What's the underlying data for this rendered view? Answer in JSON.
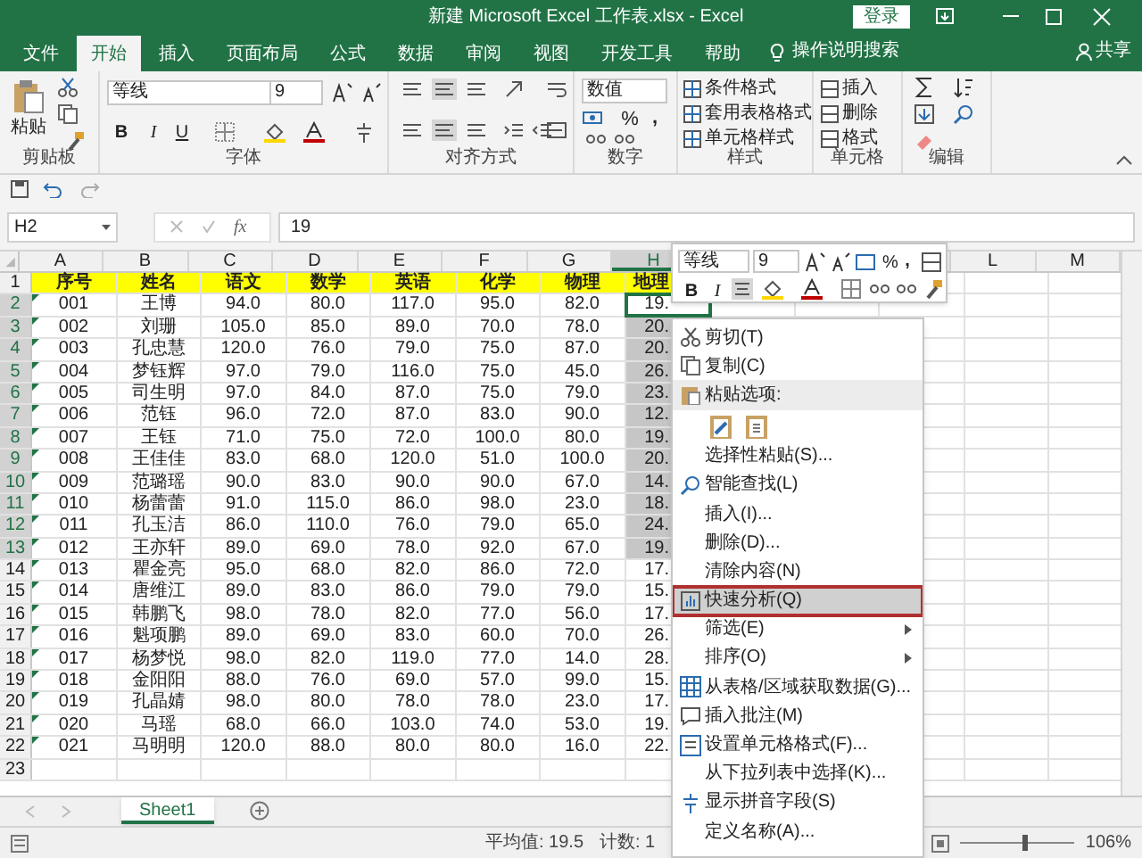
{
  "title_bar": {
    "title": "新建 Microsoft Excel 工作表.xlsx  -  Excel",
    "login": "登录"
  },
  "menu_tabs": [
    {
      "label": "文件",
      "selected": false
    },
    {
      "label": "开始",
      "selected": true
    },
    {
      "label": "插入",
      "selected": false
    },
    {
      "label": "页面布局",
      "selected": false
    },
    {
      "label": "公式",
      "selected": false
    },
    {
      "label": "数据",
      "selected": false
    },
    {
      "label": "审阅",
      "selected": false
    },
    {
      "label": "视图",
      "selected": false
    },
    {
      "label": "开发工具",
      "selected": false
    },
    {
      "label": "帮助",
      "selected": false
    }
  ],
  "tell_me": "操作说明搜索",
  "share": "共享",
  "ribbon": {
    "clipboard": {
      "paste": "粘贴",
      "label": "剪贴板"
    },
    "font": {
      "font_name": "等线",
      "font_size": "9",
      "bold": "B",
      "italic": "I",
      "underline": "U",
      "label": "字体"
    },
    "alignment": {
      "label": "对齐方式"
    },
    "number": {
      "format": "数值",
      "percent": "%",
      "comma": ",",
      "label": "数字"
    },
    "styles": {
      "buttons": [
        "条件格式",
        "套用表格格式",
        "单元格样式"
      ],
      "label": "样式"
    },
    "cells": {
      "buttons": [
        "插入",
        "删除",
        "格式"
      ],
      "label": "单元格"
    },
    "editing": {
      "label": "编辑"
    }
  },
  "formula_bar": {
    "name_box": "H2",
    "function_label": "fx",
    "value": "19"
  },
  "columns": [
    {
      "label": "A",
      "selected": false
    },
    {
      "label": "B",
      "selected": false
    },
    {
      "label": "C",
      "selected": false
    },
    {
      "label": "D",
      "selected": false
    },
    {
      "label": "E",
      "selected": false
    },
    {
      "label": "F",
      "selected": false
    },
    {
      "label": "G",
      "selected": false
    },
    {
      "label": "H",
      "selected": true
    },
    {
      "label": "L",
      "selected": false
    },
    {
      "label": "M",
      "selected": false
    }
  ],
  "rows": [
    {
      "number": "1",
      "kind": "header",
      "cells": [
        "序号",
        "姓名",
        "语文",
        "数学",
        "英语",
        "化学",
        "物理",
        "地理"
      ],
      "selected": false,
      "active": false,
      "flag": false
    },
    {
      "number": "2",
      "kind": "data",
      "cells": [
        "001",
        "王博",
        "94.0",
        "80.0",
        "117.0",
        "95.0",
        "82.0",
        "19."
      ],
      "selected": true,
      "active": true,
      "flag": true
    },
    {
      "number": "3",
      "kind": "data",
      "cells": [
        "002",
        "刘珊",
        "105.0",
        "85.0",
        "89.0",
        "70.0",
        "78.0",
        "20."
      ],
      "selected": true,
      "active": false,
      "flag": true
    },
    {
      "number": "4",
      "kind": "data",
      "cells": [
        "003",
        "孔忠慧",
        "120.0",
        "76.0",
        "79.0",
        "75.0",
        "87.0",
        "20."
      ],
      "selected": true,
      "active": false,
      "flag": true
    },
    {
      "number": "5",
      "kind": "data",
      "cells": [
        "004",
        "梦钰辉",
        "97.0",
        "79.0",
        "116.0",
        "75.0",
        "45.0",
        "26."
      ],
      "selected": true,
      "active": false,
      "flag": true
    },
    {
      "number": "6",
      "kind": "data",
      "cells": [
        "005",
        "司生明",
        "97.0",
        "84.0",
        "87.0",
        "75.0",
        "79.0",
        "23."
      ],
      "selected": true,
      "active": false,
      "flag": true
    },
    {
      "number": "7",
      "kind": "data",
      "cells": [
        "006",
        "范钰",
        "96.0",
        "72.0",
        "87.0",
        "83.0",
        "90.0",
        "12."
      ],
      "selected": true,
      "active": false,
      "flag": true
    },
    {
      "number": "8",
      "kind": "data",
      "cells": [
        "007",
        "王钰",
        "71.0",
        "75.0",
        "72.0",
        "100.0",
        "80.0",
        "19."
      ],
      "selected": true,
      "active": false,
      "flag": true
    },
    {
      "number": "9",
      "kind": "data",
      "cells": [
        "008",
        "王佳佳",
        "83.0",
        "68.0",
        "120.0",
        "51.0",
        "100.0",
        "20."
      ],
      "selected": true,
      "active": false,
      "flag": true
    },
    {
      "number": "10",
      "kind": "data",
      "cells": [
        "009",
        "范璐瑶",
        "90.0",
        "83.0",
        "90.0",
        "90.0",
        "67.0",
        "14."
      ],
      "selected": true,
      "active": false,
      "flag": true
    },
    {
      "number": "11",
      "kind": "data",
      "cells": [
        "010",
        "杨蕾蕾",
        "91.0",
        "115.0",
        "86.0",
        "98.0",
        "23.0",
        "18."
      ],
      "selected": true,
      "active": false,
      "flag": true
    },
    {
      "number": "12",
      "kind": "data",
      "cells": [
        "011",
        "孔玉洁",
        "86.0",
        "110.0",
        "76.0",
        "79.0",
        "65.0",
        "24."
      ],
      "selected": true,
      "active": false,
      "flag": true
    },
    {
      "number": "13",
      "kind": "data",
      "cells": [
        "012",
        "王亦轩",
        "89.0",
        "69.0",
        "78.0",
        "92.0",
        "67.0",
        "19."
      ],
      "selected": true,
      "active": false,
      "flag": true
    },
    {
      "number": "14",
      "kind": "data",
      "cells": [
        "013",
        "瞿金亮",
        "95.0",
        "68.0",
        "82.0",
        "86.0",
        "72.0",
        "17."
      ],
      "selected": false,
      "active": false,
      "flag": true
    },
    {
      "number": "15",
      "kind": "data",
      "cells": [
        "014",
        "唐维江",
        "89.0",
        "83.0",
        "86.0",
        "79.0",
        "79.0",
        "15."
      ],
      "selected": false,
      "active": false,
      "flag": true
    },
    {
      "number": "16",
      "kind": "data",
      "cells": [
        "015",
        "韩鹏飞",
        "98.0",
        "78.0",
        "82.0",
        "77.0",
        "56.0",
        "17."
      ],
      "selected": false,
      "active": false,
      "flag": true
    },
    {
      "number": "17",
      "kind": "data",
      "cells": [
        "016",
        "魁项鹏",
        "89.0",
        "69.0",
        "83.0",
        "60.0",
        "70.0",
        "26."
      ],
      "selected": false,
      "active": false,
      "flag": true
    },
    {
      "number": "18",
      "kind": "data",
      "cells": [
        "017",
        "杨梦悦",
        "98.0",
        "82.0",
        "119.0",
        "77.0",
        "14.0",
        "28."
      ],
      "selected": false,
      "active": false,
      "flag": true
    },
    {
      "number": "19",
      "kind": "data",
      "cells": [
        "018",
        "金阳阳",
        "88.0",
        "76.0",
        "69.0",
        "57.0",
        "99.0",
        "15."
      ],
      "selected": false,
      "active": false,
      "flag": true
    },
    {
      "number": "20",
      "kind": "data",
      "cells": [
        "019",
        "孔晶婧",
        "98.0",
        "80.0",
        "78.0",
        "78.0",
        "23.0",
        "17."
      ],
      "selected": false,
      "active": false,
      "flag": true
    },
    {
      "number": "21",
      "kind": "data",
      "cells": [
        "020",
        "马瑶",
        "68.0",
        "66.0",
        "103.0",
        "74.0",
        "53.0",
        "19."
      ],
      "selected": false,
      "active": false,
      "flag": true
    },
    {
      "number": "22",
      "kind": "data",
      "cells": [
        "021",
        "马明明",
        "120.0",
        "88.0",
        "80.0",
        "80.0",
        "16.0",
        "22."
      ],
      "selected": false,
      "active": false,
      "flag": true
    },
    {
      "number": "23",
      "kind": "data",
      "cells": [],
      "selected": false,
      "active": false,
      "flag": false
    }
  ],
  "sheet_tabs": [
    {
      "label": "Sheet1",
      "selected": true
    }
  ],
  "status_bar": {
    "average": "平均值: 19.5",
    "count": "计数: 1",
    "zoom": "106%",
    "level": 0.55
  },
  "mini_toolbar": {
    "font_name": "等线",
    "font_size": "9",
    "percent": "%",
    "comma": ",",
    "bold": "B",
    "italic": "I"
  },
  "context_menu": [
    {
      "kind": "item",
      "label": "剪切(T)",
      "submenu": false,
      "selected": false
    },
    {
      "kind": "item",
      "label": "复制(C)",
      "submenu": false,
      "selected": false
    },
    {
      "kind": "heading",
      "label": "粘贴选项:"
    },
    {
      "kind": "paste_icons"
    },
    {
      "kind": "item",
      "label": "选择性粘贴(S)...",
      "submenu": false,
      "selected": false
    },
    {
      "kind": "item",
      "label": "智能查找(L)",
      "submenu": false,
      "selected": false
    },
    {
      "kind": "item",
      "label": "插入(I)...",
      "submenu": false,
      "selected": false
    },
    {
      "kind": "item",
      "label": "删除(D)...",
      "submenu": false,
      "selected": false
    },
    {
      "kind": "item",
      "label": "清除内容(N)",
      "submenu": false,
      "selected": false
    },
    {
      "kind": "item",
      "label": "快速分析(Q)",
      "submenu": false,
      "selected": true
    },
    {
      "kind": "item",
      "label": "筛选(E)",
      "submenu": true,
      "selected": false
    },
    {
      "kind": "item",
      "label": "排序(O)",
      "submenu": true,
      "selected": false
    },
    {
      "kind": "item",
      "label": "从表格/区域获取数据(G)...",
      "submenu": false,
      "selected": false
    },
    {
      "kind": "item",
      "label": "插入批注(M)",
      "submenu": false,
      "selected": false
    },
    {
      "kind": "item",
      "label": "设置单元格格式(F)...",
      "submenu": false,
      "selected": false
    },
    {
      "kind": "item",
      "label": "从下拉列表中选择(K)...",
      "submenu": false,
      "selected": false
    },
    {
      "kind": "item",
      "label": "显示拼音字段(S)",
      "submenu": false,
      "selected": false
    },
    {
      "kind": "item",
      "label": "定义名称(A)...",
      "submenu": false,
      "selected": false
    }
  ]
}
